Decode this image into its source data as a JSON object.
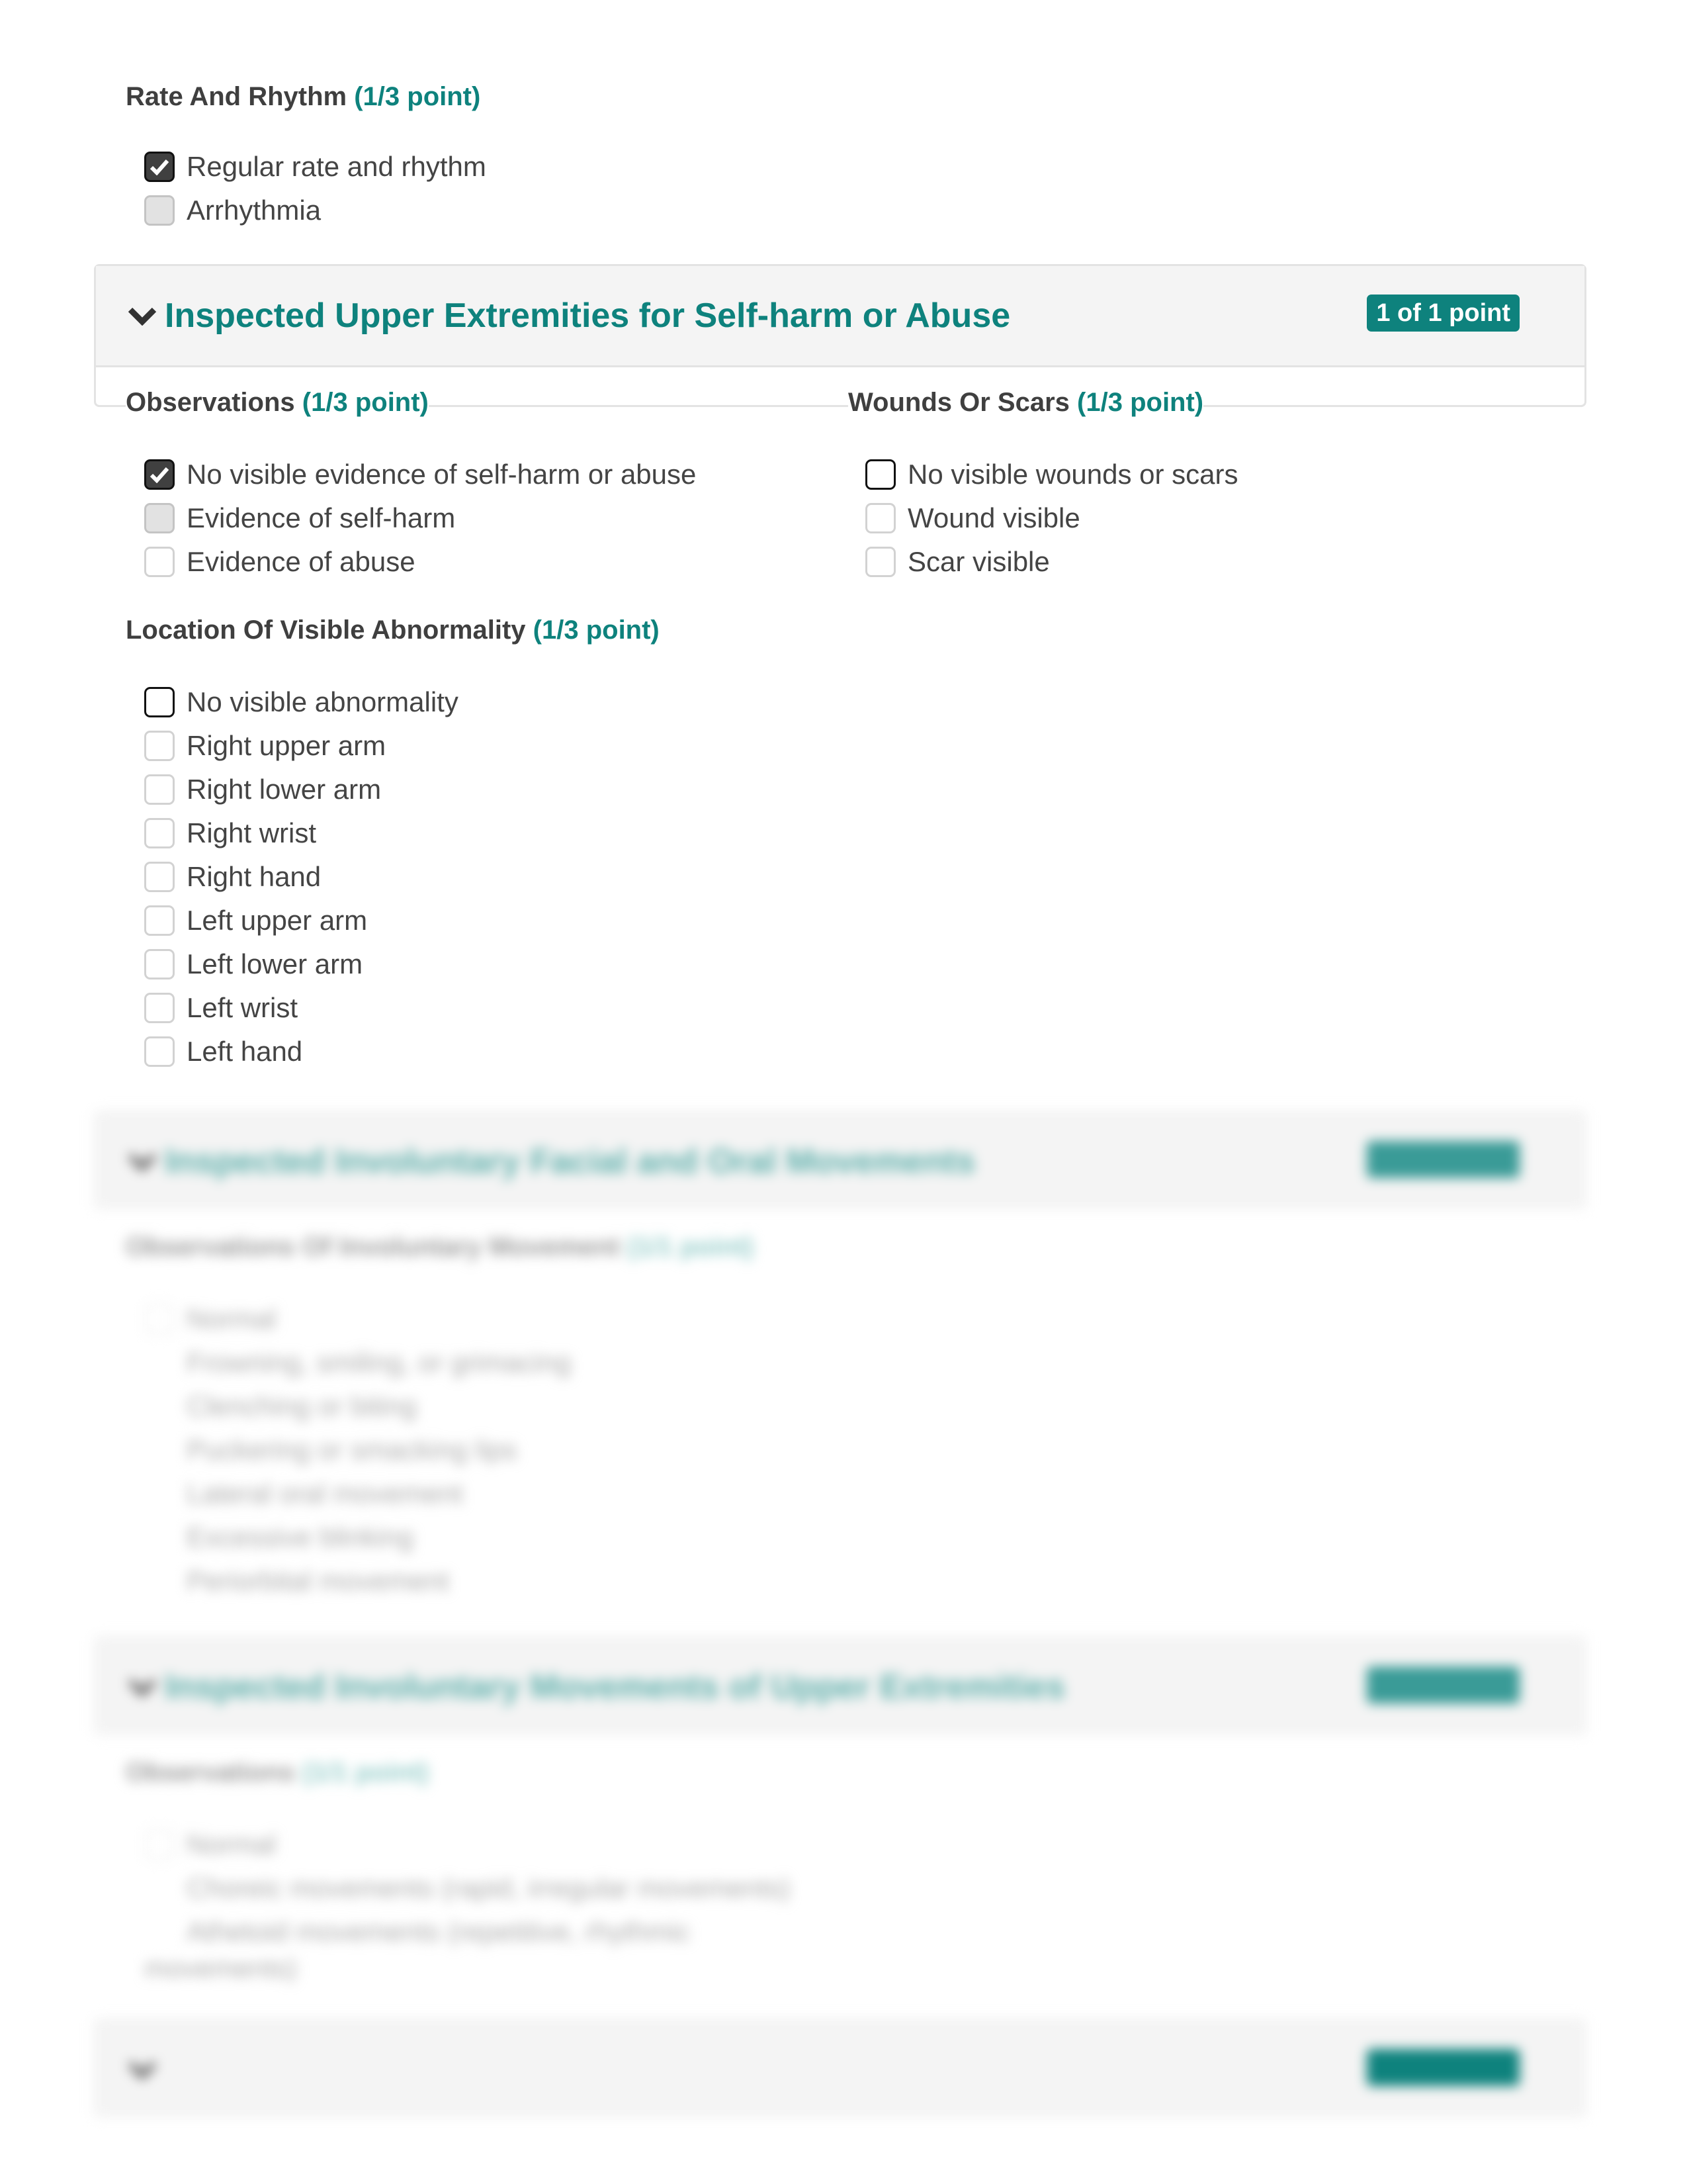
{
  "rate_rhythm": {
    "title": "Rate And Rhythm",
    "points": "(1/3 point)",
    "options": [
      {
        "label": "Regular rate and rhythm",
        "state": "checked"
      },
      {
        "label": "Arrhythmia",
        "state": "disabled"
      }
    ]
  },
  "upper_extremities": {
    "title": "Inspected Upper Extremities for Self-harm or Abuse",
    "badge": "1 of 1 point",
    "observations": {
      "title": "Observations",
      "points": "(1/3 point)",
      "options": [
        {
          "label": "No visible evidence of self-harm or abuse",
          "state": "checked"
        },
        {
          "label": "Evidence of self-harm",
          "state": "disabled"
        },
        {
          "label": "Evidence of abuse",
          "state": "unchecked"
        }
      ]
    },
    "wounds": {
      "title": "Wounds Or Scars",
      "points": "(1/3 point)",
      "options": [
        {
          "label": "No visible wounds or scars",
          "state": "expected"
        },
        {
          "label": "Wound visible",
          "state": "unchecked"
        },
        {
          "label": "Scar visible",
          "state": "unchecked"
        }
      ]
    },
    "location": {
      "title": "Location Of Visible Abnormality",
      "points": "(1/3 point)",
      "options": [
        {
          "label": "No visible abnormality",
          "state": "expected"
        },
        {
          "label": "Right upper arm",
          "state": "unchecked"
        },
        {
          "label": "Right lower arm",
          "state": "unchecked"
        },
        {
          "label": "Right wrist",
          "state": "unchecked"
        },
        {
          "label": "Right hand",
          "state": "unchecked"
        },
        {
          "label": "Left upper arm",
          "state": "unchecked"
        },
        {
          "label": "Left lower arm",
          "state": "unchecked"
        },
        {
          "label": "Left wrist",
          "state": "unchecked"
        },
        {
          "label": "Left hand",
          "state": "unchecked"
        }
      ]
    }
  },
  "blurred_facial": {
    "title": "Inspected Involuntary Facial and Oral Movements",
    "badge": "1 of 1 point",
    "question": "Observations Of Involuntary Movement",
    "points": "(1/1 point)",
    "options": [
      "Normal",
      "Frowning, smiling, or grimacing",
      "Clenching or biting",
      "Puckering or smacking lips",
      "Lateral oral movement",
      "Excessive blinking",
      "Periorbital movement"
    ]
  },
  "blurred_upper": {
    "title": "Inspected Involuntary Movements of Upper Extremities",
    "badge": "1 of 1 point",
    "question": "Observations",
    "points": "(1/1 point)",
    "options": [
      "Normal",
      "Choreic movements (rapid, irregular movements)",
      "Athetoid movements (repetitive, rhythmic",
      "movements)"
    ]
  },
  "blurred_next": {
    "badge": "1 of 1 point"
  },
  "colors": {
    "accent": "#0e827d",
    "heading": "#3f3f3f",
    "text": "#444444",
    "panel_bg": "#f4f4f4"
  }
}
